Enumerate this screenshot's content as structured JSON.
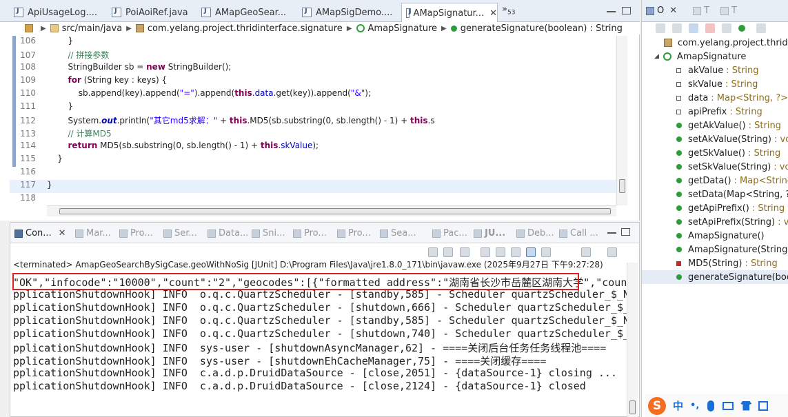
{
  "editor": {
    "tabs": [
      {
        "label": "ApiUsageLog...."
      },
      {
        "label": "PoiAoiRef.java"
      },
      {
        "label": "AMapGeoSear..."
      },
      {
        "label": "AMapSigDemo...."
      },
      {
        "label": "AMapSignatur..."
      }
    ],
    "tab_close": "✕",
    "overflow_label": "»",
    "overflow_count": "53",
    "breadcrumb": {
      "path1": "src/main/java",
      "path2": "com.yelang.project.thridinterface.signature",
      "path3": "AmapSignature",
      "path4": "generateSignature(boolean) : String"
    },
    "code_lines": [
      {
        "num": "106"
      },
      {
        "num": "107"
      },
      {
        "num": "108"
      },
      {
        "num": "109"
      },
      {
        "num": "110"
      },
      {
        "num": "111"
      },
      {
        "num": "112"
      },
      {
        "num": "113"
      },
      {
        "num": "114"
      },
      {
        "num": "115"
      },
      {
        "num": "116"
      },
      {
        "num": "117"
      },
      {
        "num": "118"
      }
    ],
    "code_text": {
      "l106": "}",
      "l107_comment": "// 拼接参数",
      "l108_a": "StringBuilder sb = ",
      "l108_kw": "new",
      "l108_b": " StringBuilder();",
      "l109_kw": "for",
      "l109_a": " (String key : keys) {",
      "l110_a": "sb.append(key).append(",
      "l110_s1": "\"=\"",
      "l110_b": ").append(",
      "l110_kw": "this",
      "l110_c": ".",
      "l110_fld": "data",
      "l110_d": ".get(key)).append(",
      "l110_s2": "\"&\"",
      "l110_e": ");",
      "l111": "}",
      "l112_a": "System.",
      "l112_out": "out",
      "l112_b": ".println(",
      "l112_s": "\"其它md5求解：\"",
      "l112_c": " + ",
      "l112_kw": "this",
      "l112_d": ".MD5(sb.substring(0, sb.length() - 1) + ",
      "l112_kw2": "this",
      "l112_e": ".s",
      "l113_comment": "// 计算MD5",
      "l114_kw": "return",
      "l114_a": " MD5(sb.substring(0, sb.length() - 1) + ",
      "l114_kw2": "this",
      "l114_b": ".",
      "l114_fld": "skValue",
      "l114_c": ");",
      "l115": "}",
      "l117": "}"
    }
  },
  "console": {
    "tabs": [
      {
        "label": "Con..."
      },
      {
        "label": "Mar..."
      },
      {
        "label": "Pro..."
      },
      {
        "label": "Ser..."
      },
      {
        "label": "Data..."
      },
      {
        "label": "Sni..."
      },
      {
        "label": "Pro..."
      },
      {
        "label": "Pro..."
      },
      {
        "label": "Sea..."
      },
      {
        "label": "Pac..."
      },
      {
        "label": "JU..."
      },
      {
        "label": "Deb..."
      },
      {
        "label": "Call ..."
      }
    ],
    "terminated_text": "<terminated> AmapGeoSearchBySigCase.geoWithNoSig [JUnit] D:\\Program Files\\Java\\jre1.8.0_171\\bin\\javaw.exe (2025年9月27日 下午9:27:28)",
    "lines": [
      "\"OK\",\"infocode\":\"10000\",\"count\":\"2\",\"geocodes\":[{\"formatted_address\":\"湖南省长沙市岳麓区湖南大学\",\"country\":",
      "pplicationShutdownHook] INFO  o.q.c.QuartzScheduler - [standby,585] - Scheduler quartzScheduler_$_N",
      "pplicationShutdownHook] INFO  o.q.c.QuartzScheduler - [shutdown,666] - Scheduler quartzScheduler_$_",
      "pplicationShutdownHook] INFO  o.q.c.QuartzScheduler - [standby,585] - Scheduler quartzScheduler_$_N",
      "pplicationShutdownHook] INFO  o.q.c.QuartzScheduler - [shutdown,740] - Scheduler quartzScheduler_$_",
      "pplicationShutdownHook] INFO  sys-user - [shutdownAsyncManager,62] - ====关闭后台任务任务线程池====",
      "pplicationShutdownHook] INFO  sys-user - [shutdownEhCacheManager,75] - ====关闭缓存====",
      "pplicationShutdownHook] INFO  c.a.d.p.DruidDataSource - [close,2051] - {dataSource-1} closing ...",
      "pplicationShutdownHook] INFO  c.a.d.p.DruidDataSource - [close,2124] - {dataSource-1} closed"
    ]
  },
  "outline": {
    "tabs": [
      {
        "label": "O"
      },
      {
        "label": "T"
      },
      {
        "label": "T"
      }
    ],
    "package": "com.yelang.project.thridint",
    "class_name": "AmapSignature",
    "members": [
      {
        "name": "akValue",
        "type": ": String",
        "kind": "field"
      },
      {
        "name": "skValue",
        "type": ": String",
        "kind": "field"
      },
      {
        "name": "data",
        "type": ": Map<String, ?>",
        "kind": "field"
      },
      {
        "name": "apiPrefix",
        "type": ": String",
        "kind": "field"
      },
      {
        "name": "getAkValue()",
        "type": ": String",
        "kind": "method"
      },
      {
        "name": "setAkValue(String)",
        "type": ": void",
        "kind": "method"
      },
      {
        "name": "getSkValue()",
        "type": ": String",
        "kind": "method"
      },
      {
        "name": "setSkValue(String)",
        "type": ": void",
        "kind": "method"
      },
      {
        "name": "getData()",
        "type": ": Map<String,",
        "kind": "method"
      },
      {
        "name": "setData(Map<String, ?>",
        "type": "",
        "kind": "method"
      },
      {
        "name": "getApiPrefix()",
        "type": ": String",
        "kind": "method"
      },
      {
        "name": "setApiPrefix(String)",
        "type": ": void",
        "kind": "method"
      },
      {
        "name": "AmapSignature()",
        "type": "",
        "kind": "ctor"
      },
      {
        "name": "AmapSignature(String, S",
        "type": "",
        "kind": "ctor"
      },
      {
        "name": "MD5(String)",
        "type": ": String",
        "kind": "private"
      },
      {
        "name": "generateSignature(bool",
        "type": "",
        "kind": "method"
      }
    ]
  },
  "ime": {
    "logo": "S",
    "mode": "中",
    "punct": "•,"
  },
  "colors": {
    "accent": "#506e9a",
    "red_box": "#e02020",
    "field_red": "#c82828",
    "method_green": "#2e9e3a"
  }
}
